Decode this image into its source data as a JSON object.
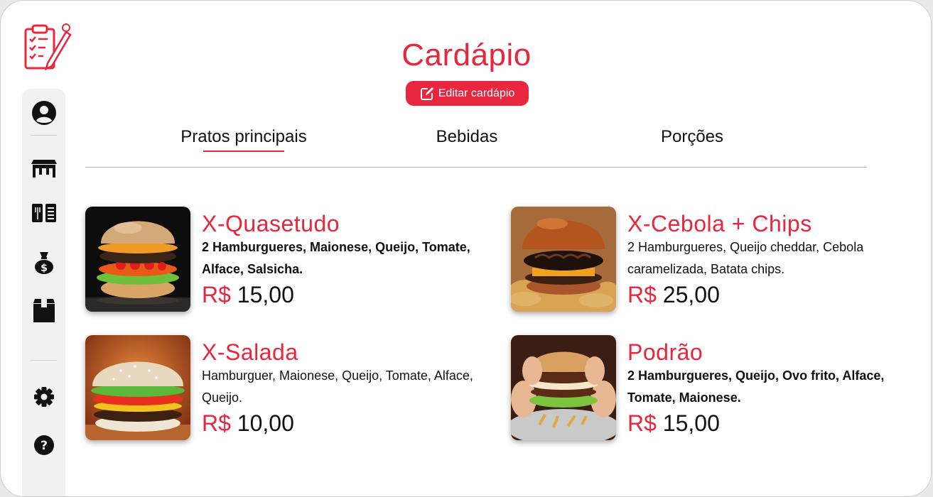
{
  "page": {
    "title": "Cardápio",
    "edit_button_label": "Editar cardápio"
  },
  "sidebar": {
    "items": [
      {
        "icon": "user-circle-icon"
      },
      {
        "icon": "table-icon"
      },
      {
        "icon": "menu-book-icon"
      },
      {
        "icon": "money-bag-icon"
      },
      {
        "icon": "box-icon"
      },
      {
        "icon": "gear-icon"
      },
      {
        "icon": "help-icon"
      }
    ]
  },
  "tabs": [
    {
      "label": "Pratos principais",
      "active": true
    },
    {
      "label": "Bebidas",
      "active": false
    },
    {
      "label": "Porções",
      "active": false
    }
  ],
  "items": [
    {
      "name": "X-Quasetudo",
      "description": "2 Hamburgueres, Maionese, Queijo, Tomate, Alface, Salsicha.",
      "currency": "R$",
      "price": "15,00"
    },
    {
      "name": "X-Cebola + Chips",
      "description": "2 Hamburgueres, Queijo cheddar, Cebola caramelizada, Batata chips.",
      "currency": "R$",
      "price": "25,00"
    },
    {
      "name": "X-Salada",
      "description": "Hamburguer, Maionese, Queijo, Tomate, Alface, Queijo.",
      "currency": "R$",
      "price": "10,00"
    },
    {
      "name": "Podrão",
      "description": "2 Hamburgueres, Queijo,  Ovo frito, Alface, Tomate, Maionese.",
      "currency": "R$",
      "price": "15,00"
    }
  ],
  "colors": {
    "accent": "#e8263e",
    "text": "#111111",
    "sidebar_bg": "#f1f1f1"
  }
}
